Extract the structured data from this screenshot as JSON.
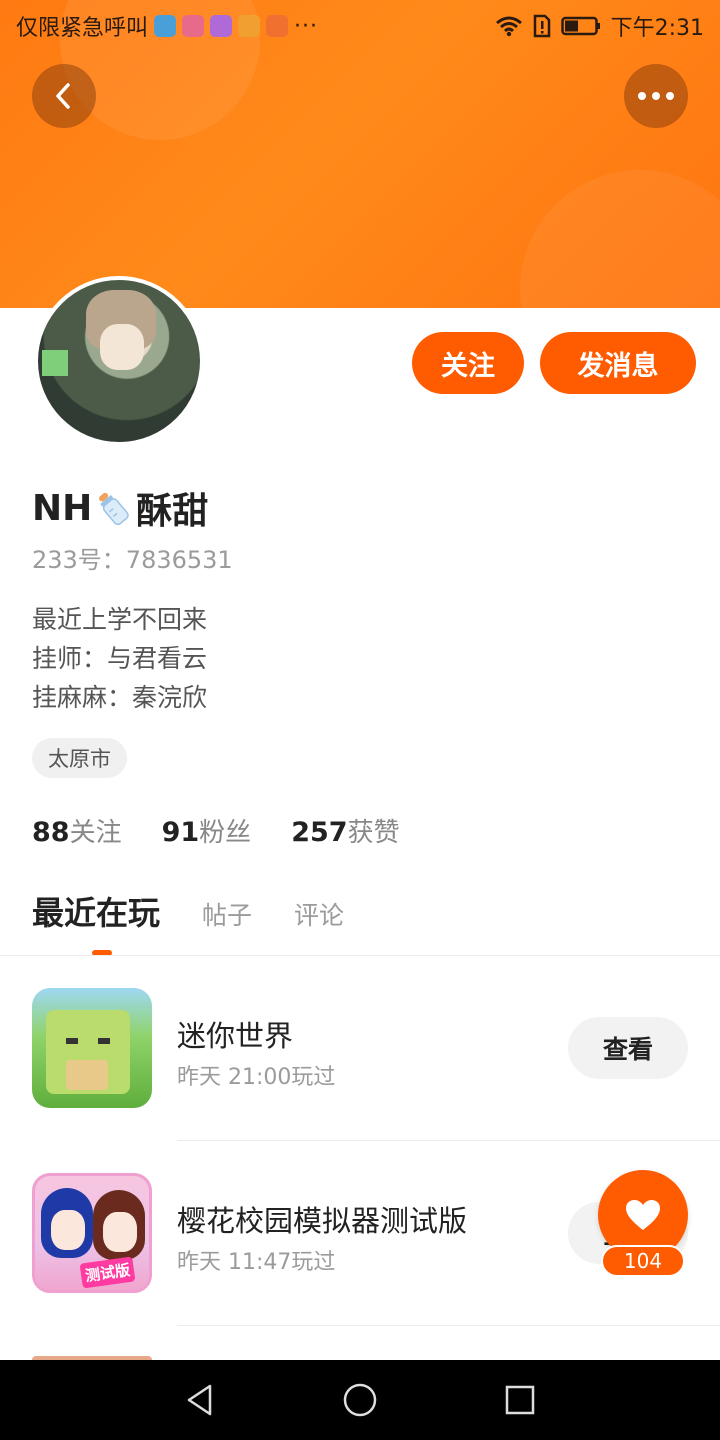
{
  "status_bar": {
    "carrier": "仅限紧急呼叫",
    "more_dots": "···",
    "time": "下午2:31"
  },
  "profile": {
    "name_prefix": "NH",
    "name_suffix": "酥甜",
    "uid": "233号：7836531",
    "bio": [
      "最近上学不回来",
      "挂师：与君看云",
      "挂麻麻：秦浣欣"
    ],
    "city": "太原市",
    "follow_label": "关注",
    "message_label": "发消息"
  },
  "stats": [
    {
      "num": "88",
      "label": "关注"
    },
    {
      "num": "91",
      "label": "粉丝"
    },
    {
      "num": "257",
      "label": "获赞"
    }
  ],
  "tabs": [
    {
      "label": "最近在玩",
      "active": true
    },
    {
      "label": "帖子",
      "active": false
    },
    {
      "label": "评论",
      "active": false
    }
  ],
  "games": [
    {
      "title": "迷你世界",
      "played": "昨天 21:00玩过",
      "action": "查看"
    },
    {
      "title": "樱花校园模拟器测试版",
      "played": "昨天 11:47玩过",
      "action": "查看",
      "icon_tag": "测试版"
    }
  ],
  "like": {
    "count": "104"
  },
  "colors": {
    "accent": "#ff5b00",
    "banner": "#ff7a12"
  },
  "icons": {
    "back": "chevron-left-icon",
    "more": "more-horizontal-icon",
    "like": "heart-icon"
  }
}
